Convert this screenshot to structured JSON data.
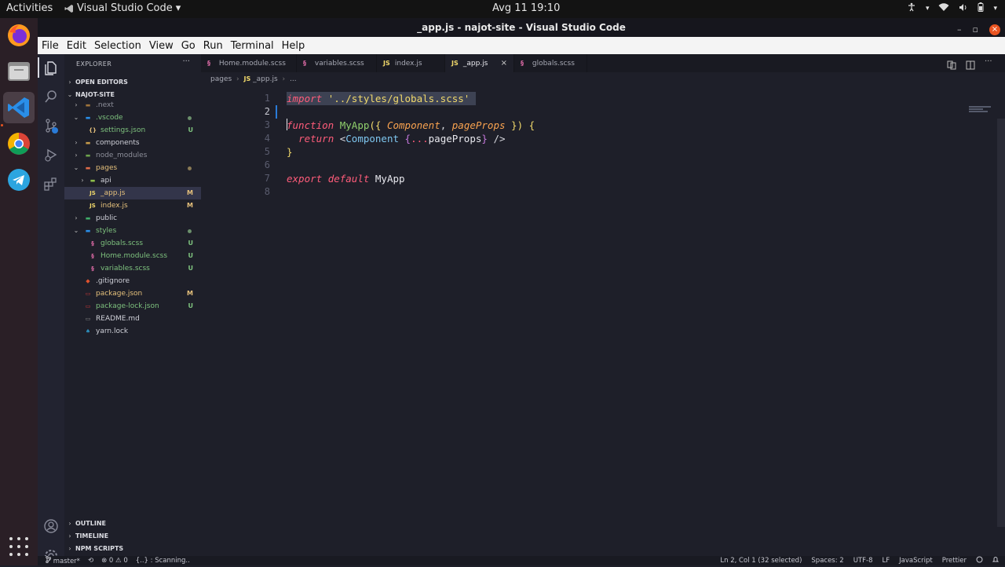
{
  "system": {
    "activities": "Activities",
    "app_name": "Visual Studio Code",
    "app_menu_caret": "▾",
    "clock": "Avg 11  19:10"
  },
  "window": {
    "title": "_app.js - najot-site - Visual Studio Code",
    "min": "–",
    "max": "▫",
    "close": "×"
  },
  "menu": [
    "File",
    "Edit",
    "Selection",
    "View",
    "Go",
    "Run",
    "Terminal",
    "Help"
  ],
  "sidebar": {
    "header": "EXPLORER",
    "more": "···",
    "open_editors": "OPEN EDITORS",
    "project": "NAJOT-SITE",
    "tree": [
      {
        "name": ".next",
        "badge": ""
      },
      {
        "name": ".vscode",
        "badge": ""
      },
      {
        "name": "settings.json",
        "badge": "U"
      },
      {
        "name": "components",
        "badge": ""
      },
      {
        "name": "node_modules",
        "badge": ""
      },
      {
        "name": "pages",
        "badge": ""
      },
      {
        "name": "api",
        "badge": ""
      },
      {
        "name": "_app.js",
        "badge": "M"
      },
      {
        "name": "index.js",
        "badge": "M"
      },
      {
        "name": "public",
        "badge": ""
      },
      {
        "name": "styles",
        "badge": ""
      },
      {
        "name": "globals.scss",
        "badge": "U"
      },
      {
        "name": "Home.module.scss",
        "badge": "U"
      },
      {
        "name": "variables.scss",
        "badge": "U"
      },
      {
        "name": ".gitignore",
        "badge": ""
      },
      {
        "name": "package.json",
        "badge": "M"
      },
      {
        "name": "package-lock.json",
        "badge": "U"
      },
      {
        "name": "README.md",
        "badge": ""
      },
      {
        "name": "yarn.lock",
        "badge": ""
      }
    ],
    "outline": "OUTLINE",
    "timeline": "TIMELINE",
    "npm_scripts": "NPM SCRIPTS"
  },
  "tabs": [
    {
      "label": "Home.module.scss",
      "icon": "scss-icon"
    },
    {
      "label": "variables.scss",
      "icon": "scss-icon"
    },
    {
      "label": "index.js",
      "icon": "js-icon"
    },
    {
      "label": "_app.js",
      "icon": "js-icon"
    },
    {
      "label": "globals.scss",
      "icon": "scss-icon"
    }
  ],
  "js_label": "JS",
  "breadcrumb": {
    "folder": "pages",
    "file": "_app.js",
    "more": "...",
    "sep": "›"
  },
  "editor": {
    "line_numbers": [
      "1",
      "2",
      "3",
      "4",
      "5",
      "6",
      "7",
      "8"
    ],
    "code": {
      "import_kw": "import",
      "import_path": "'../styles/globals.scss'",
      "function_kw": "function",
      "fn_name": "MyApp",
      "open_paren_brace": "({",
      "param1": "Component",
      "comma": ",",
      "param2": "pageProps",
      "close_brace_paren": "})",
      "open_brace": "{",
      "return_kw": "return",
      "jsx_open": "<",
      "jsx_tag": "Component",
      "spread_open": "{",
      "spread_dots": "...",
      "spread_id": "pageProps",
      "spread_close": "}",
      "jsx_close": "/>",
      "close_brace": "}",
      "export_kw": "export",
      "default_kw": "default",
      "export_id": "MyApp"
    }
  },
  "status": {
    "branch": "master*",
    "sync": "⟲",
    "problems": "⊗ 0 ⚠ 0",
    "scanning": "{..} : Scanning..",
    "position": "Ln 2, Col 1 (32 selected)",
    "spaces": "Spaces: 2",
    "encoding": "UTF-8",
    "eol": "LF",
    "language": "JavaScript",
    "formatter": "Prettier"
  },
  "colors": {
    "accent": "#e95420",
    "keyword": "#ff5c7a",
    "string": "#f1d96b",
    "function": "#90d06c",
    "param": "#f8a24f",
    "modified": "#e5c07b",
    "untracked": "#7ec27e"
  }
}
